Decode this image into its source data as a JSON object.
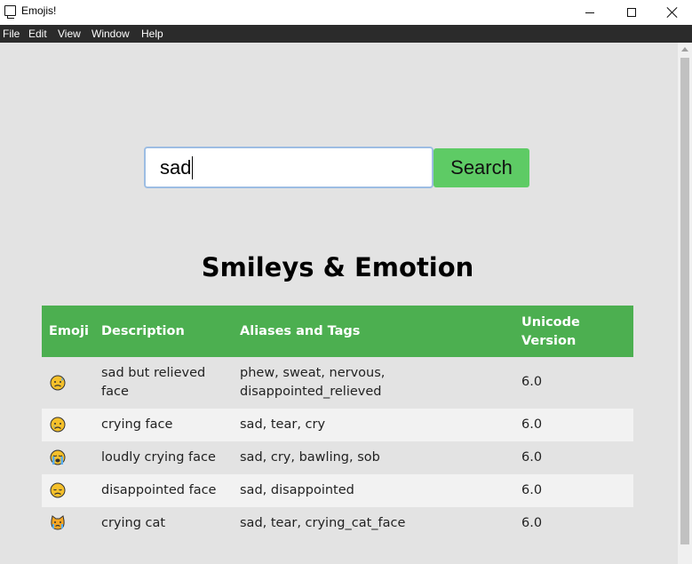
{
  "window": {
    "title": "Emojis!"
  },
  "menu": [
    "File",
    "Edit",
    "View",
    "Window",
    "Help"
  ],
  "search": {
    "value": "sad",
    "button_label": "Search"
  },
  "section_title": "Smileys & Emotion",
  "table": {
    "headers": {
      "emoji": "Emoji",
      "description": "Description",
      "aliases": "Aliases and Tags",
      "unicode": "Unicode Version"
    },
    "rows": [
      {
        "emoji_icon": "sad-but-relieved-face-icon",
        "description": "sad but relieved face",
        "aliases": "phew, sweat, nervous, disappointed_relieved",
        "unicode": "6.0"
      },
      {
        "emoji_icon": "crying-face-icon",
        "description": "crying face",
        "aliases": "sad, tear, cry",
        "unicode": "6.0"
      },
      {
        "emoji_icon": "loudly-crying-face-icon",
        "description": "loudly crying face",
        "aliases": "sad, cry, bawling, sob",
        "unicode": "6.0"
      },
      {
        "emoji_icon": "disappointed-face-icon",
        "description": "disappointed face",
        "aliases": "sad, disappointed",
        "unicode": "6.0"
      },
      {
        "emoji_icon": "crying-cat-icon",
        "description": "crying cat",
        "aliases": "sad, tear, crying_cat_face",
        "unicode": "6.0"
      }
    ]
  },
  "colors": {
    "header_green": "#4caf50",
    "button_green": "#5ecb65",
    "menubar": "#2b2b2b",
    "emoji_yellow": "#f5c02a"
  }
}
